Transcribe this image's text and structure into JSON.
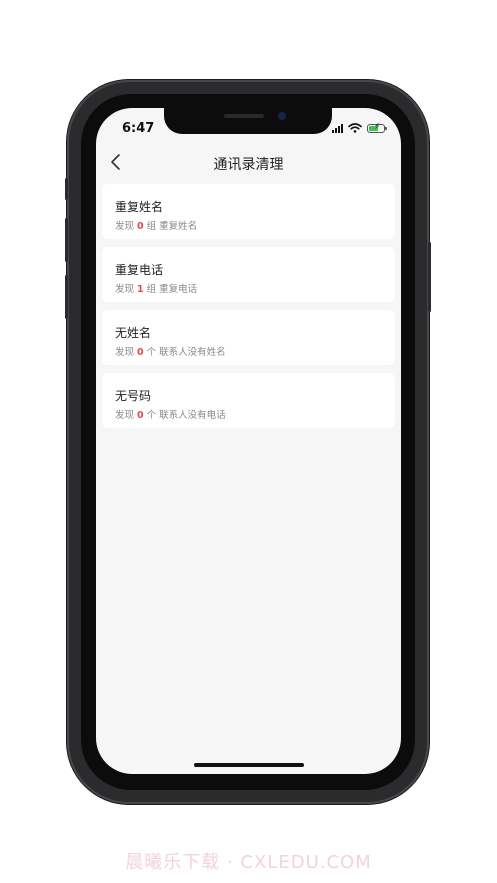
{
  "status": {
    "time": "6:47"
  },
  "nav": {
    "title": "通讯录清理"
  },
  "items": [
    {
      "title": "重复姓名",
      "prefix": "发现",
      "count": "0",
      "suffix": "组 重复姓名"
    },
    {
      "title": "重复电话",
      "prefix": "发现",
      "count": "1",
      "suffix": "组 重复电话"
    },
    {
      "title": "无姓名",
      "prefix": "发现",
      "count": "0",
      "suffix": "个 联系人没有姓名"
    },
    {
      "title": "无号码",
      "prefix": "发现",
      "count": "0",
      "suffix": "个 联系人没有电话"
    }
  ],
  "watermark": "晨曦乐下载 · CXLEDU.COM",
  "colors": {
    "accent_count": "#e5484d",
    "screen_bg": "#f6f6f6",
    "card_bg": "#ffffff",
    "battery": "#3ec34e"
  }
}
